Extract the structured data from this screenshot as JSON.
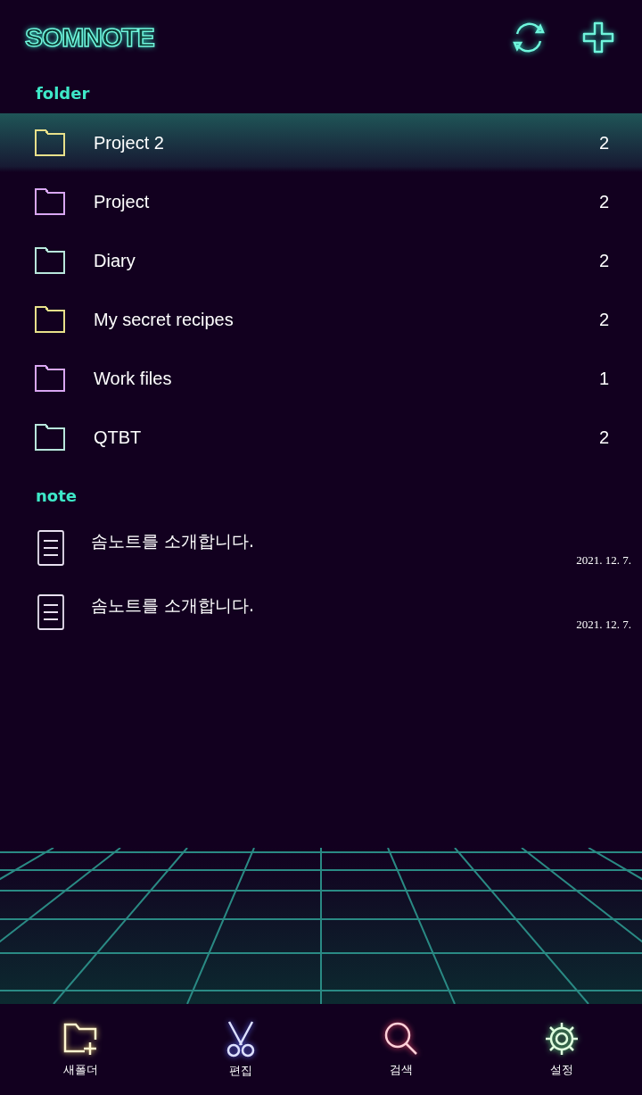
{
  "app": {
    "logo": "SOMNOTE"
  },
  "folder_section": {
    "label": "folder"
  },
  "folders": [
    {
      "name": "Project 2",
      "count": "2",
      "color": "#e8e08a",
      "selected": true
    },
    {
      "name": "Project",
      "count": "2",
      "color": "#d9a6f2",
      "selected": false
    },
    {
      "name": "Diary",
      "count": "2",
      "color": "#b8e6dc",
      "selected": false
    },
    {
      "name": "My secret recipes",
      "count": "2",
      "color": "#e8e08a",
      "selected": false
    },
    {
      "name": "Work files",
      "count": "1",
      "color": "#d9a6f2",
      "selected": false
    },
    {
      "name": "QTBT",
      "count": "2",
      "color": "#b8e6dc",
      "selected": false
    }
  ],
  "note_section": {
    "label": "note"
  },
  "notes": [
    {
      "title": "솜노트를 소개합니다.",
      "date": "2021. 12. 7."
    },
    {
      "title": "솜노트를 소개합니다.",
      "date": "2021. 12. 7."
    }
  ],
  "bottom_nav": [
    {
      "kind": "new-folder",
      "label": "새폴더"
    },
    {
      "kind": "edit",
      "label": "편집"
    },
    {
      "kind": "search",
      "label": "검색"
    },
    {
      "kind": "settings",
      "label": "설정"
    }
  ]
}
